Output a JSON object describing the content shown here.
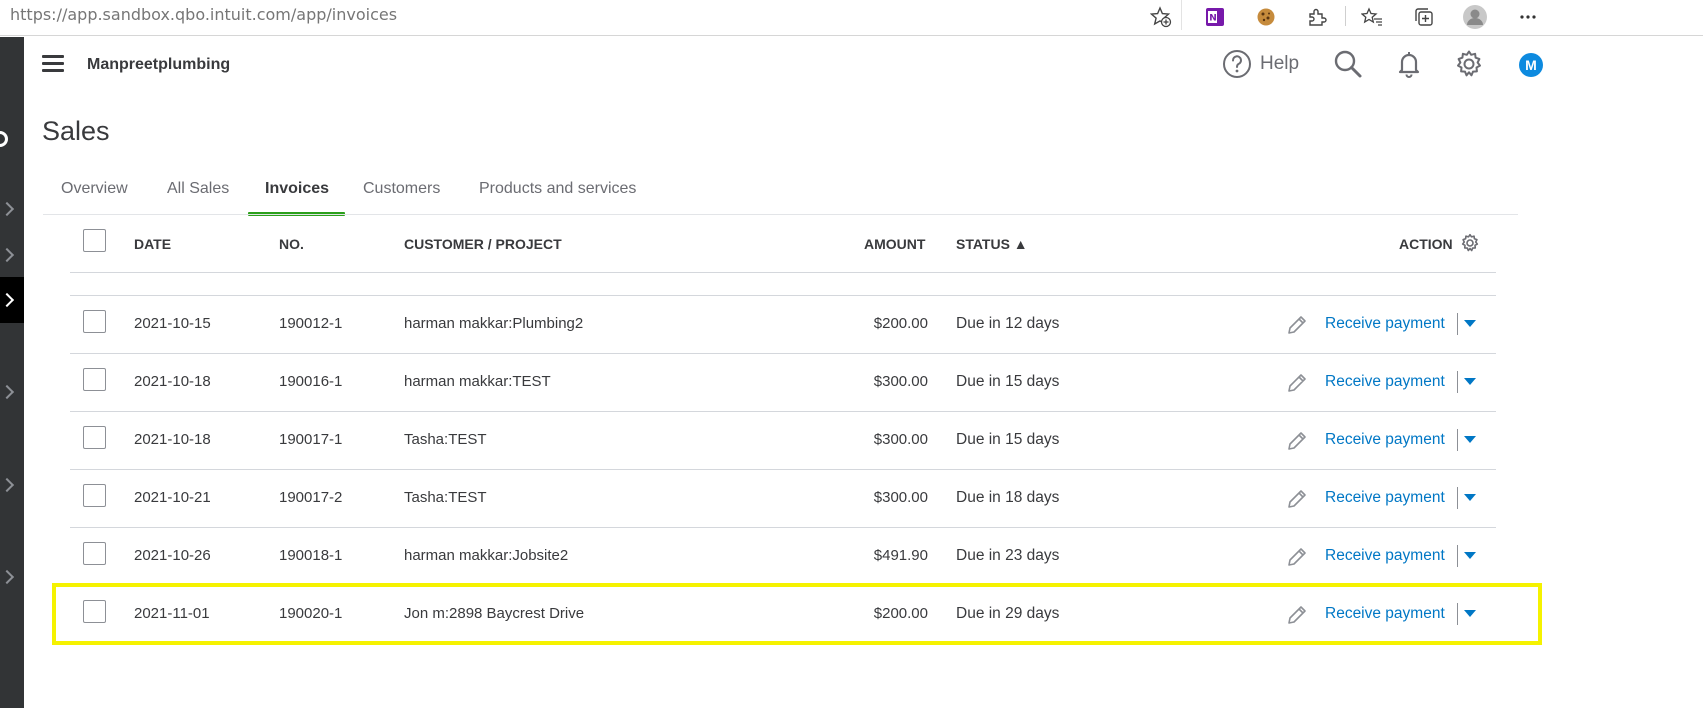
{
  "browser": {
    "url_host": "https://app.sandbox.qbo.intuit.com",
    "url_path": "/app/invoices"
  },
  "header": {
    "company": "Manpreetplumbing",
    "help_label": "Help",
    "avatar_letter": "M"
  },
  "page": {
    "title": "Sales"
  },
  "tabs": [
    {
      "label": "Overview"
    },
    {
      "label": "All Sales"
    },
    {
      "label": "Invoices"
    },
    {
      "label": "Customers"
    },
    {
      "label": "Products and services"
    }
  ],
  "table": {
    "columns": {
      "date": "DATE",
      "no": "NO.",
      "customer": "CUSTOMER / PROJECT",
      "amount": "AMOUNT",
      "status": "STATUS ▲",
      "action": "ACTION"
    },
    "rows": [
      {
        "date": "2021-10-15",
        "no": "190012-1",
        "customer": "harman makkar:Plumbing2",
        "amount": "$200.00",
        "status": "Due in 12 days",
        "action": "Receive payment"
      },
      {
        "date": "2021-10-18",
        "no": "190016-1",
        "customer": "harman makkar:TEST",
        "amount": "$300.00",
        "status": "Due in 15 days",
        "action": "Receive payment"
      },
      {
        "date": "2021-10-18",
        "no": "190017-1",
        "customer": "Tasha:TEST",
        "amount": "$300.00",
        "status": "Due in 15 days",
        "action": "Receive payment"
      },
      {
        "date": "2021-10-21",
        "no": "190017-2",
        "customer": "Tasha:TEST",
        "amount": "$300.00",
        "status": "Due in 18 days",
        "action": "Receive payment"
      },
      {
        "date": "2021-10-26",
        "no": "190018-1",
        "customer": "harman makkar:Jobsite2",
        "amount": "$491.90",
        "status": "Due in 23 days",
        "action": "Receive payment"
      },
      {
        "date": "2021-11-01",
        "no": "190020-1",
        "customer": "Jon m:2898 Baycrest Drive",
        "amount": "$200.00",
        "status": "Due in 29 days",
        "action": "Receive payment"
      }
    ]
  },
  "colors": {
    "accent_green": "#2ca01c",
    "link_blue": "#0077c5",
    "highlight_yellow": "#f5f200",
    "nav_dark": "#323436"
  }
}
